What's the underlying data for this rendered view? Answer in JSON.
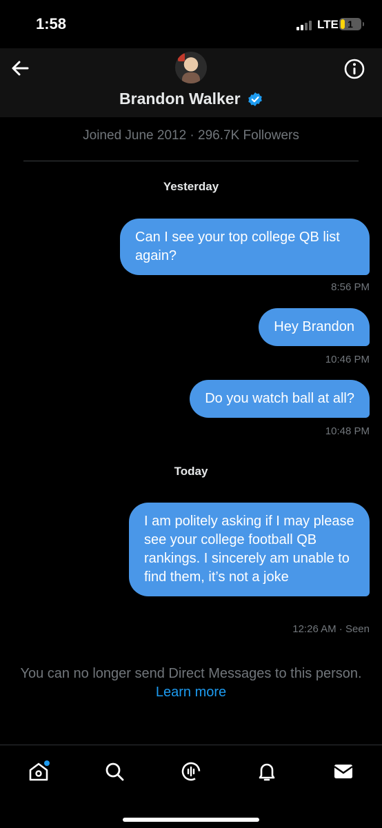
{
  "status_bar": {
    "time": "1:58",
    "network": "LTE",
    "battery": "1"
  },
  "header": {
    "name": "Brandon Walker",
    "verified": true,
    "back_icon": "arrow-left-icon",
    "info_icon": "info-circle-icon"
  },
  "profile": {
    "joined_text": "Joined June 2012 · 296.7K Followers"
  },
  "conversation": {
    "days": [
      {
        "label": "Yesterday",
        "messages": [
          {
            "text": "Can I see your top college QB list again?",
            "time": "8:56 PM"
          },
          {
            "text": "Hey Brandon",
            "time": "10:46 PM"
          },
          {
            "text": "Do you watch ball at all?",
            "time": "10:48 PM"
          }
        ]
      },
      {
        "label": "Today",
        "messages": [
          {
            "text": "I am politely asking if I may please see your college football QB rankings. I sincerely am unable to find them, it’s not a joke",
            "time": "12:26 AM · Seen"
          }
        ]
      }
    ]
  },
  "notice": {
    "text": "You can no longer send Direct Messages to this person.",
    "link": "Learn more"
  },
  "tabbar": {
    "items": [
      "home-icon",
      "search-icon",
      "spaces-icon",
      "notifications-icon",
      "messages-icon"
    ],
    "home_has_badge": true
  },
  "colors": {
    "bubble": "#4a97e8",
    "accent": "#1d9bf0",
    "background": "#000000"
  }
}
